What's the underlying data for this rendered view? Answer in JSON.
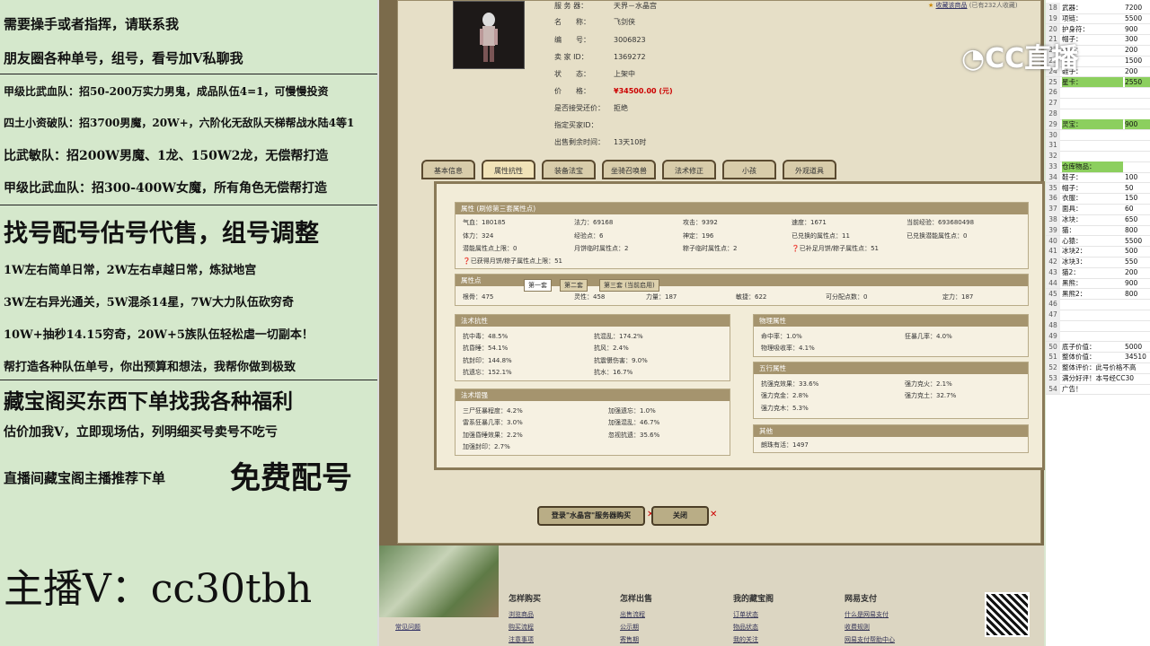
{
  "left_panel": {
    "lines": [
      "需要操手或者指挥，请联系我",
      "朋友圈各种单号，组号，看号加V私聊我",
      "甲级比武血队：招50-200万实力男鬼，成品队伍4=1，可慢慢投资",
      "四土小资破队：招3700男魔，20W+，六阶化无敌队天梯帮战水陆4等1",
      "比武敏队：招200W男魔、1龙、150W2龙，无偿帮打造",
      "甲级比武血队：招300-400W女魔，所有角色无偿帮打造",
      "找号配号估号代售，组号调整",
      "1W左右简单日常，2W左右卓越日常，炼狱地宫",
      "3W左右异光通关，5W混杀14星，7W大力队伍砍穷奇",
      "10W+抽秒14.15穷奇，20W+5族队伍轻松虐一切副本！",
      "帮打造各种队伍单号，你出预算和想法，我帮你做到极致",
      "藏宝阁买东西下单找我各种福利",
      "估价加我V，立即现场估，列明细买号卖号不吃亏",
      "直播间藏宝阁主播推荐下单",
      "免费配号",
      "主播V：cc30tbh"
    ]
  },
  "item": {
    "server_label": "服 务 器：",
    "server": "天界－水晶宫",
    "name_label": "名　　称：",
    "name": "飞剑侠",
    "id_label": "编　　号：",
    "id": "3006823",
    "seller_label": "卖 家 ID：",
    "seller": "1369272",
    "status_label": "状　　态：",
    "status": "上架中",
    "price_label": "价　　格：",
    "price": "¥34500.00 (元)",
    "bargain_label": "是否接受还价：",
    "bargain": "拒绝",
    "buyer_label": "指定买家ID：",
    "buyer": "",
    "time_label": "出售剩余时间：",
    "time": "13天10时",
    "fav": "收藏该商品",
    "fav_count": "(已有232人收藏)"
  },
  "tabs": [
    "基本信息",
    "属性抗性",
    "装备法宝",
    "坐骑召唤兽",
    "法术修正",
    "小孩",
    "外观道具"
  ],
  "attr_box": {
    "title": "属性 (刷修第三套属性点)",
    "rows": [
      [
        "气血：180185",
        "法力：69168",
        "攻击：9392",
        "速度：1671",
        "当前经验：693680498"
      ],
      [
        "体力：324",
        "经验点：6",
        "神定：196",
        "已兑换的属性点：11",
        "已兑换潜能属性点：0"
      ],
      [
        "潜能属性点上限：0",
        "月饼临时属性点：2",
        "粽子临时属性点：2",
        "已补足月饼/粽子属性点：51",
        ""
      ]
    ],
    "extra": "已获得月饼/粽子属性点上限：51"
  },
  "points_box": {
    "title": "属性点",
    "subtabs": [
      "第一套",
      "第二套",
      "第三套 (当前启用)"
    ],
    "values": [
      "根骨：475",
      "灵性：458",
      "力量：187",
      "敏捷：622",
      "可分配点数：0",
      "定力：187"
    ]
  },
  "resist_box": {
    "title": "法术抗性",
    "cells": [
      "抗中毒：48.5%",
      "抗混乱：174.2%",
      "抗昏睡：54.1%",
      "抗风：2.4%",
      "抗封印：144.8%",
      "抗震慑伤害：9.0%",
      "抗遗忘：152.1%",
      "抗水：16.7%"
    ]
  },
  "boost_box": {
    "title": "法术增强",
    "cells": [
      "三尸狂暴程度：4.2%",
      "加强遗忘：1.0%",
      "雷系狂暴几率：3.0%",
      "加强混乱：46.7%",
      "加强昏睡效果：2.2%",
      "忽视抗遗：35.6%",
      "加强封印：2.7%",
      ""
    ]
  },
  "phys_box": {
    "title": "物理属性",
    "cells": [
      "命中率：1.0%",
      "狂暴几率：4.0%",
      "物理吸收率：4.1%",
      ""
    ]
  },
  "five_box": {
    "title": "五行属性",
    "cells": [
      "抗强克效果：33.6%",
      "强力克火：2.1%",
      "强力克金：2.8%",
      "强力克土：32.7%",
      "强力克木：5.3%",
      ""
    ]
  },
  "other_box": {
    "title": "其他",
    "cells": [
      "朗珠有活：1497"
    ]
  },
  "buttons": {
    "buy": "登录\"水晶宫\"服务器购买",
    "close": "关闭"
  },
  "footer": {
    "cols": [
      {
        "h": "怎样购买",
        "links": [
          "浏览商品",
          "购买流程",
          "注意事项"
        ]
      },
      {
        "h": "怎样出售",
        "links": [
          "出售流程",
          "公示期",
          "寄售期"
        ]
      },
      {
        "h": "我的藏宝阁",
        "links": [
          "订单状态",
          "物品状态",
          "我的关注"
        ]
      },
      {
        "h": "网易支付",
        "links": [
          "什么是网易支付",
          "收费规则",
          "网易支付帮助中心"
        ]
      }
    ],
    "thumb_label": "常见问题"
  },
  "watermark": "CC直播",
  "sheet": [
    {
      "n": "18",
      "a": "武器：",
      "b": "7200"
    },
    {
      "n": "19",
      "a": "项链：",
      "b": "5500"
    },
    {
      "n": "20",
      "a": "护身符：",
      "b": "900"
    },
    {
      "n": "21",
      "a": "帽子：",
      "b": "300"
    },
    {
      "n": "22",
      "a": "鞋子：",
      "b": "200"
    },
    {
      "n": "23",
      "a": "",
      "b": "1500"
    },
    {
      "n": "24",
      "a": "鞋子：",
      "b": "200"
    },
    {
      "n": "25",
      "a": "星卡：",
      "b": "2550",
      "hl": true
    },
    {
      "n": "26",
      "a": "",
      "b": ""
    },
    {
      "n": "27",
      "a": "",
      "b": ""
    },
    {
      "n": "28",
      "a": "",
      "b": ""
    },
    {
      "n": "29",
      "a": "灵宝：",
      "b": "900",
      "hl": true
    },
    {
      "n": "30",
      "a": "",
      "b": ""
    },
    {
      "n": "31",
      "a": "",
      "b": ""
    },
    {
      "n": "32",
      "a": "",
      "b": ""
    },
    {
      "n": "33",
      "a": "仓库物品：",
      "b": "",
      "hl": true
    },
    {
      "n": "34",
      "a": "鞋子：",
      "b": "100"
    },
    {
      "n": "35",
      "a": "帽子：",
      "b": "50"
    },
    {
      "n": "36",
      "a": "衣服：",
      "b": "150"
    },
    {
      "n": "37",
      "a": "面具：",
      "b": "60"
    },
    {
      "n": "38",
      "a": "冰块：",
      "b": "650"
    },
    {
      "n": "39",
      "a": "猫：",
      "b": "800"
    },
    {
      "n": "40",
      "a": "心猿：",
      "b": "5500"
    },
    {
      "n": "41",
      "a": "冰块2：",
      "b": "500"
    },
    {
      "n": "42",
      "a": "冰块3：",
      "b": "550"
    },
    {
      "n": "43",
      "a": "猫2：",
      "b": "200"
    },
    {
      "n": "44",
      "a": "黑熊：",
      "b": "900"
    },
    {
      "n": "45",
      "a": "黑熊2：",
      "b": "800"
    },
    {
      "n": "46",
      "a": "",
      "b": ""
    },
    {
      "n": "47",
      "a": "",
      "b": ""
    },
    {
      "n": "48",
      "a": "",
      "b": ""
    },
    {
      "n": "49",
      "a": "",
      "b": ""
    },
    {
      "n": "50",
      "a": "底子价值：",
      "b": "5000"
    },
    {
      "n": "51",
      "a": "整体价值：",
      "b": "34510"
    },
    {
      "n": "52",
      "a": "整体评价：此号价格不高",
      "b": ""
    },
    {
      "n": "53",
      "a": "满分好评！本号经CC30",
      "b": ""
    },
    {
      "n": "54",
      "a": "广告！",
      "b": ""
    }
  ]
}
